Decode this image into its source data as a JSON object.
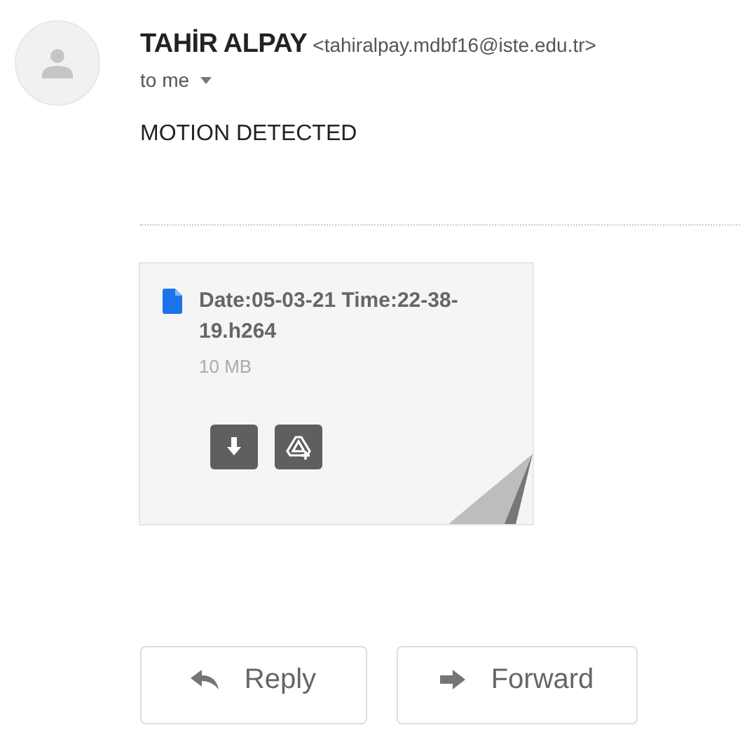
{
  "sender": {
    "name": "TAHİR ALPAY",
    "email": "<tahiralpay.mdbf16@iste.edu.tr>"
  },
  "recipient": "to me",
  "subject": "MOTION DETECTED",
  "attachment": {
    "filename": "Date:05-03-21 Time:22-38-19.h264",
    "size": "10 MB"
  },
  "actions": [
    {
      "label": "Reply",
      "kind": "reply"
    },
    {
      "label": "Forward",
      "kind": "forward"
    }
  ]
}
